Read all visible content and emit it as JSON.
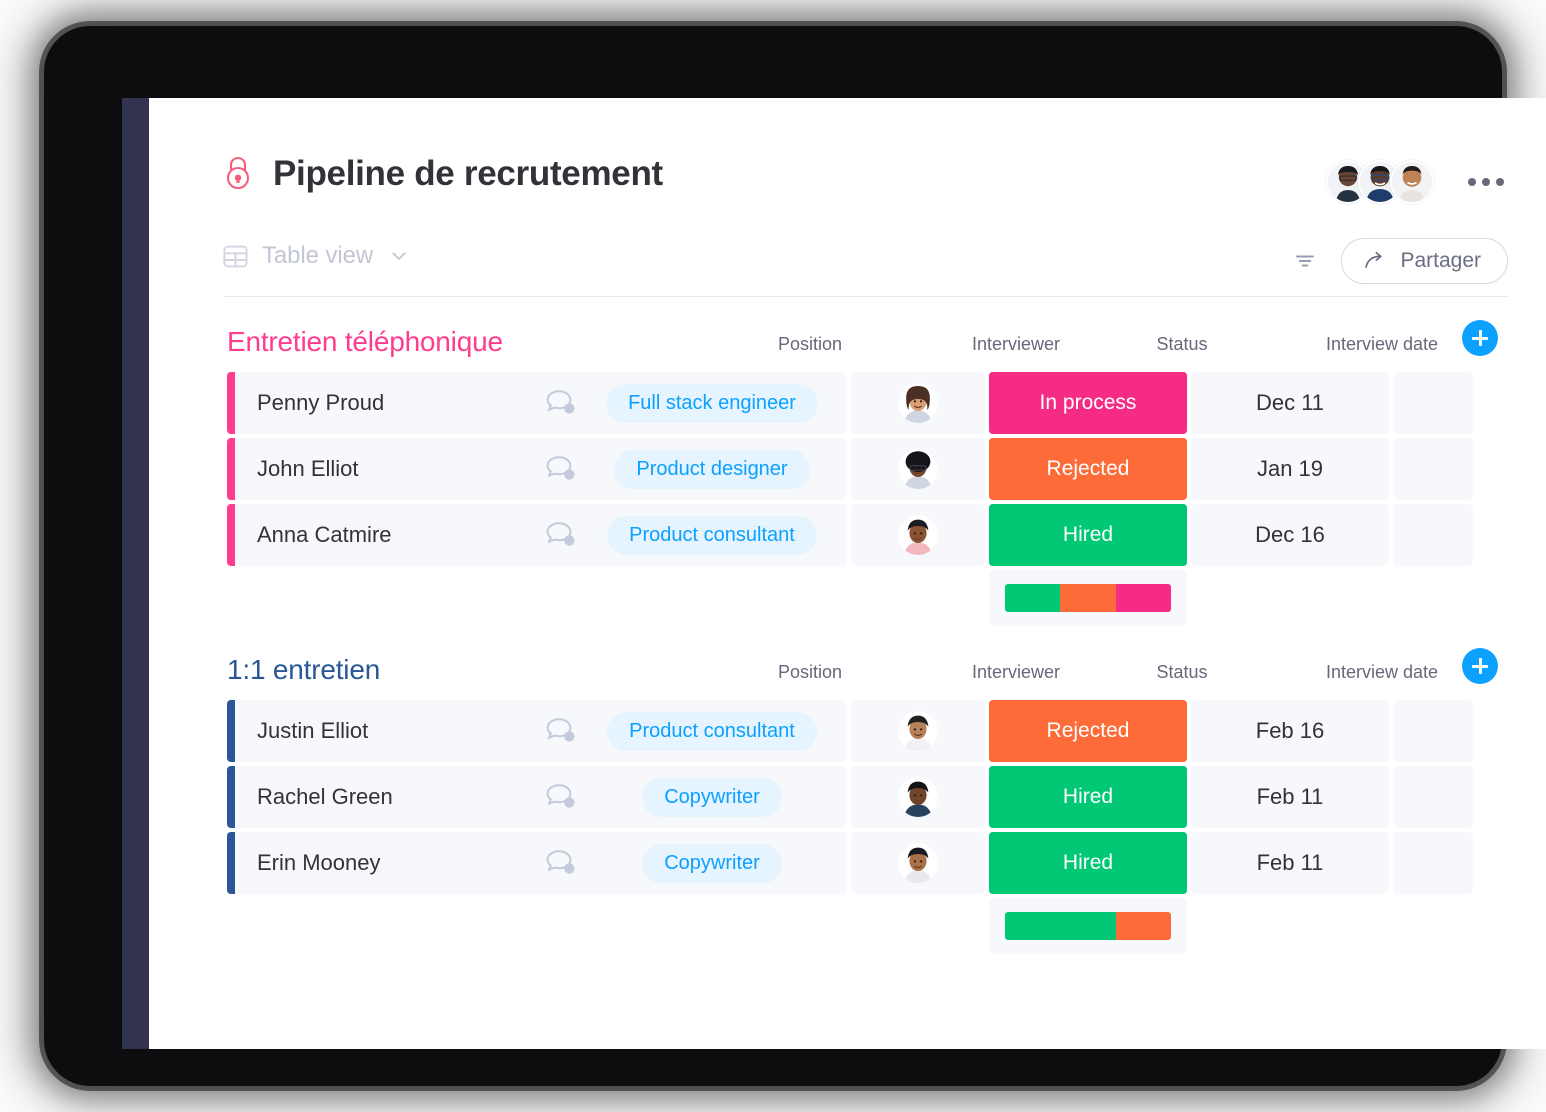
{
  "board": {
    "title": "Pipeline de recrutement",
    "lock_icon": "lock-icon",
    "more_menu_icon": "more-menu-icon"
  },
  "toolbar": {
    "view_icon": "table-view-icon",
    "view_label": "Table view",
    "chevron_icon": "chevron-down-icon",
    "filter_icon": "filter-icon",
    "share_icon": "share-arrow-icon",
    "share_label": "Partager"
  },
  "columns": {
    "name": "",
    "position": "Position",
    "interviewer": "Interviewer",
    "status": "Status",
    "date": "Interview date"
  },
  "colors": {
    "accent_blue": "#0ca0ff",
    "group_pink": "#ff3c8e",
    "group_blue": "#2b5797",
    "status_in_process": "#f62b86",
    "status_rejected": "#fd6c38",
    "status_hired": "#00c875",
    "tag_bg": "#e5f4ff",
    "tag_text": "#0ca0ff",
    "cell_bg": "#f6f8fb",
    "rail": "#32344f"
  },
  "add_button_label": "+",
  "groups": [
    {
      "title": "Entretien téléphonique",
      "color": "#ff3c8e",
      "rows": [
        {
          "name": "Penny Proud",
          "position": "Full stack engineer",
          "interviewer": "avatar-penny-interviewer",
          "status": "In process",
          "status_color": "#f62b86",
          "date": "Dec 11"
        },
        {
          "name": "John Elliot",
          "position": "Product designer",
          "interviewer": "avatar-john-interviewer",
          "status": "Rejected",
          "status_color": "#fd6c38",
          "date": "Jan 19"
        },
        {
          "name": "Anna Catmire",
          "position": "Product consultant",
          "interviewer": "avatar-anna-interviewer",
          "status": "Hired",
          "status_color": "#00c875",
          "date": "Dec 16"
        }
      ],
      "summary": [
        {
          "color": "#00c875",
          "percent": 33.4
        },
        {
          "color": "#fd6c38",
          "percent": 33.3
        },
        {
          "color": "#f62b86",
          "percent": 33.3
        }
      ]
    },
    {
      "title": "1:1 entretien",
      "color": "#2b5797",
      "rows": [
        {
          "name": "Justin Elliot",
          "position": "Product consultant",
          "interviewer": "avatar-justin-interviewer",
          "status": "Rejected",
          "status_color": "#fd6c38",
          "date": "Feb 16"
        },
        {
          "name": "Rachel Green",
          "position": "Copywriter",
          "interviewer": "avatar-rachel-interviewer",
          "status": "Hired",
          "status_color": "#00c875",
          "date": "Feb 11"
        },
        {
          "name": "Erin Mooney",
          "position": "Copywriter",
          "interviewer": "avatar-erin-interviewer",
          "status": "Hired",
          "status_color": "#00c875",
          "date": "Feb 11"
        }
      ],
      "summary": [
        {
          "color": "#00c875",
          "percent": 66.7
        },
        {
          "color": "#fd6c38",
          "percent": 33.3
        }
      ]
    }
  ],
  "header_avatars": [
    "avatar-member-1",
    "avatar-member-2",
    "avatar-member-3"
  ]
}
